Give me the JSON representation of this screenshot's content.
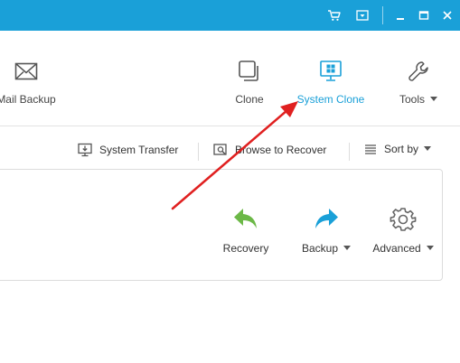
{
  "titlebar": {
    "background": "#1aa0d8",
    "buttons": [
      {
        "name": "cart-icon"
      },
      {
        "name": "menu-dropdown-icon"
      },
      {
        "name": "minimize-icon"
      },
      {
        "name": "maximize-icon"
      },
      {
        "name": "close-icon"
      }
    ]
  },
  "toolbar": {
    "mail_backup_label": "Mail Backup",
    "clone_label": "Clone",
    "system_clone_label": "System Clone",
    "tools_label": "Tools",
    "accent_color": "#1aa0d8"
  },
  "actionbar": {
    "system_transfer_label": "System Transfer",
    "browse_to_recover_label": "Browse to Recover",
    "sort_by_label": "Sort by"
  },
  "card": {
    "recovery_label": "Recovery",
    "backup_label": "Backup",
    "advanced_label": "Advanced",
    "recovery_color": "#6cb847",
    "backup_color": "#1aa0d8"
  },
  "annotation": {
    "arrow_color": "#e02020"
  }
}
